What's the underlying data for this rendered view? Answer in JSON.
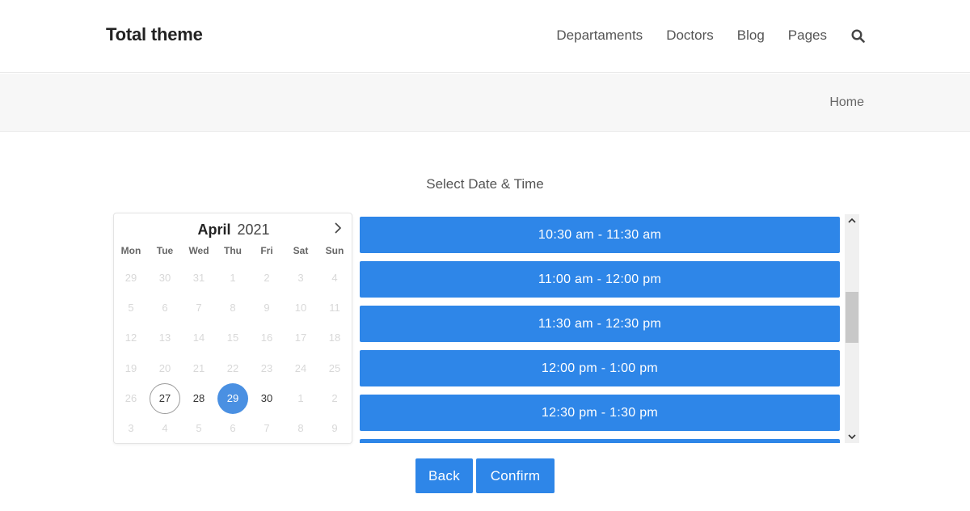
{
  "site": {
    "logo": "Total theme"
  },
  "nav": {
    "items": [
      "Departaments",
      "Doctors",
      "Blog",
      "Pages"
    ],
    "search_icon": "search-icon"
  },
  "breadcrumb": {
    "home": "Home"
  },
  "booking": {
    "title": "Select Date & Time"
  },
  "calendar": {
    "month": "April",
    "year": "2021",
    "next_icon": "chevron-right-icon",
    "weekdays": [
      "Mon",
      "Tue",
      "Wed",
      "Thu",
      "Fri",
      "Sat",
      "Sun"
    ],
    "weeks": [
      [
        "29",
        "30",
        "31",
        "1",
        "2",
        "3",
        "4"
      ],
      [
        "5",
        "6",
        "7",
        "8",
        "9",
        "10",
        "11"
      ],
      [
        "12",
        "13",
        "14",
        "15",
        "16",
        "17",
        "18"
      ],
      [
        "19",
        "20",
        "21",
        "22",
        "23",
        "24",
        "25"
      ],
      [
        "26",
        "27",
        "28",
        "29",
        "30",
        "1",
        "2"
      ],
      [
        "3",
        "4",
        "5",
        "6",
        "7",
        "8",
        "9"
      ]
    ],
    "available_days": [
      "27",
      "28",
      "29",
      "30"
    ],
    "today": "27",
    "selected": "29"
  },
  "time_slots": [
    "10:30 am - 11:30 am",
    "11:00 am - 12:00 pm",
    "11:30 am - 12:30 pm",
    "12:00 pm - 1:00 pm",
    "12:30 pm - 1:30 pm",
    ""
  ],
  "actions": {
    "back": "Back",
    "confirm": "Confirm"
  },
  "colors": {
    "accent": "#2e86e8",
    "selected_day": "#4a90e2"
  }
}
